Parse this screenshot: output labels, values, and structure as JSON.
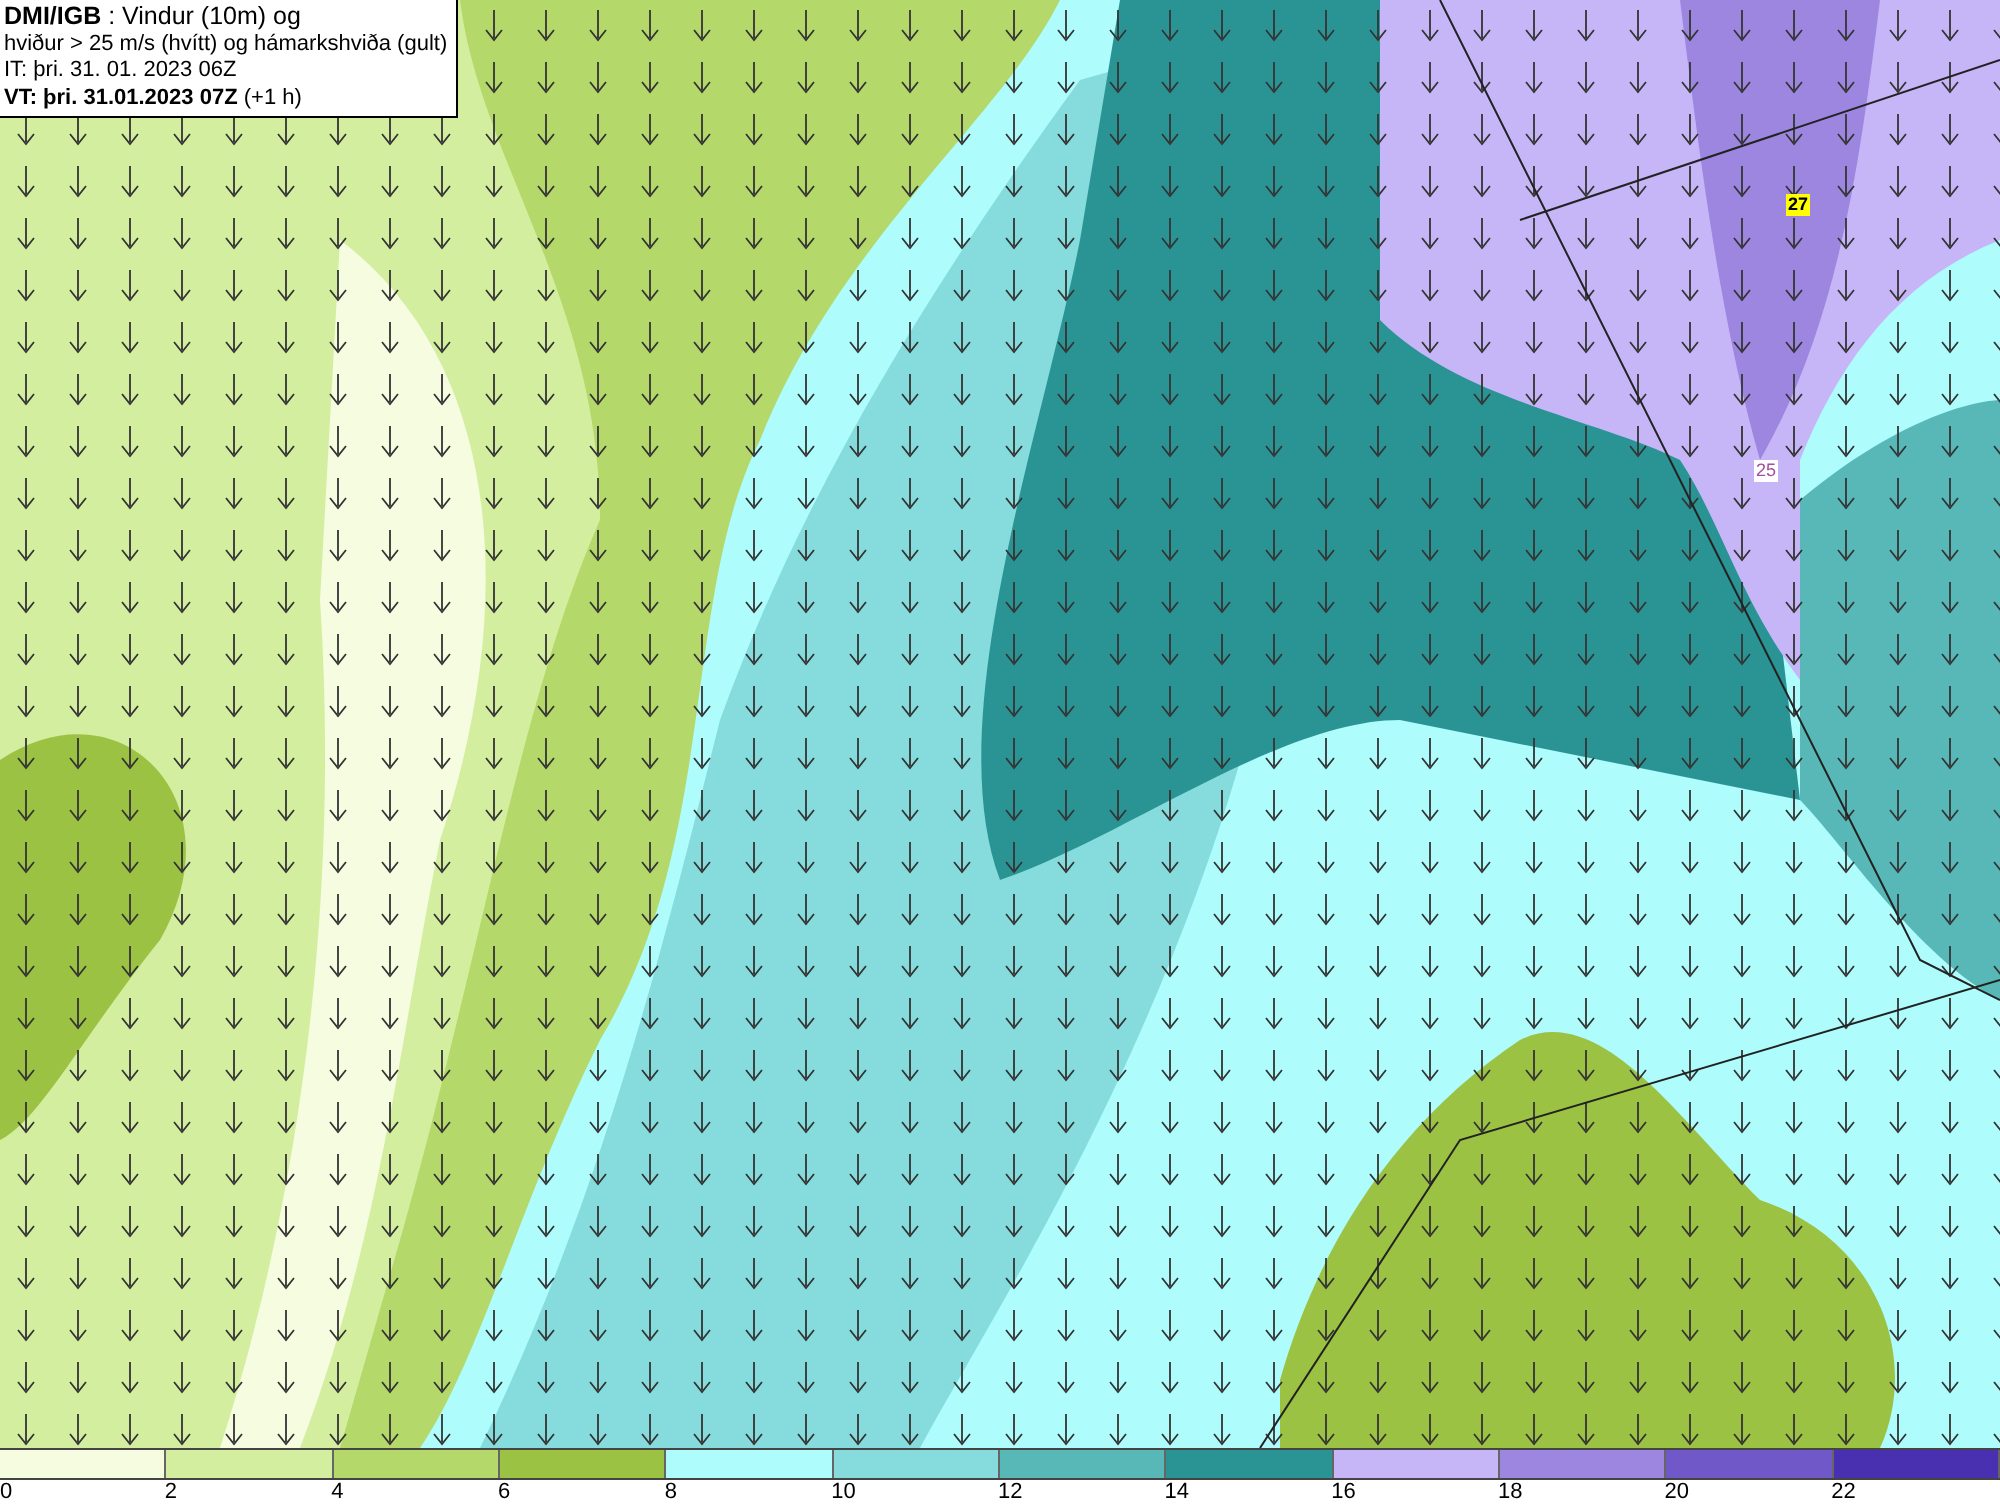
{
  "title_box": {
    "lines": [
      "**DMI/IGB** : Vindur (10m) og",
      "hviður > 25 m/s (hvítt) og hámarkshviða (gult)",
      "IT: þri. 31. 01. 2023 06Z",
      "**VT: þri. 31.01.2023 07Z** (+1 h)"
    ]
  },
  "map_labels": [
    {
      "text": "27",
      "kind": "max_gust"
    },
    {
      "text": "25",
      "kind": "gust_contour"
    }
  ],
  "legend": {
    "bins": [
      {
        "color": "#f5fce0"
      },
      {
        "color": "#d4eea0"
      },
      {
        "color": "#b4d86a"
      },
      {
        "color": "#9cc244"
      },
      {
        "color": "#aefcfc"
      },
      {
        "color": "#86dcdc"
      },
      {
        "color": "#58b8b8"
      },
      {
        "color": "#2a9494"
      },
      {
        "color": "#c6b6f8"
      },
      {
        "color": "#9c86e0"
      },
      {
        "color": "#7058c8"
      },
      {
        "color": "#4830b0"
      }
    ],
    "ticks": [
      "0",
      "2",
      "4",
      "6",
      "8",
      "10",
      "12",
      "14",
      "16",
      "18",
      "20",
      "22"
    ]
  }
}
